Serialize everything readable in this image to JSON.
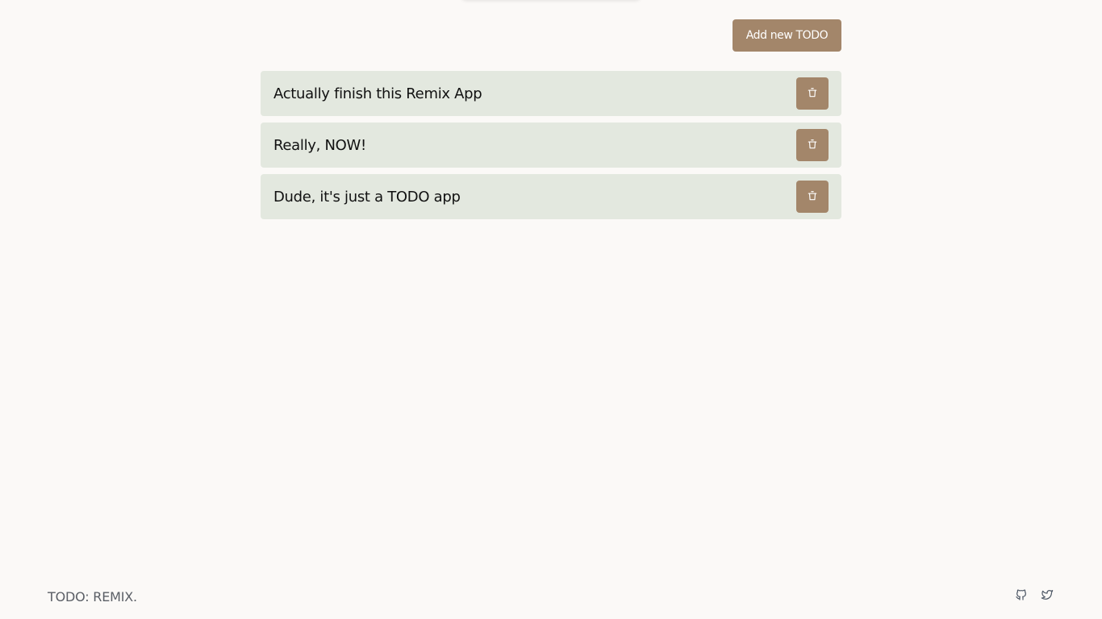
{
  "toolbar": {
    "add_label": "Add new TODO"
  },
  "todos": [
    {
      "text": "Actually finish this Remix App",
      "delete_icon": "trash-icon"
    },
    {
      "text": "Really, NOW!",
      "delete_icon": "trash-icon"
    },
    {
      "text": "Dude, it's just a TODO app",
      "delete_icon": "trash-icon"
    }
  ],
  "footer": {
    "brand": "TODO: REMIX.",
    "links": [
      {
        "icon": "github-icon"
      },
      {
        "icon": "twitter-icon"
      }
    ]
  },
  "colors": {
    "accent": "#a3866a",
    "item_background": "#e3e8df",
    "page_background": "#fbf9f7"
  }
}
